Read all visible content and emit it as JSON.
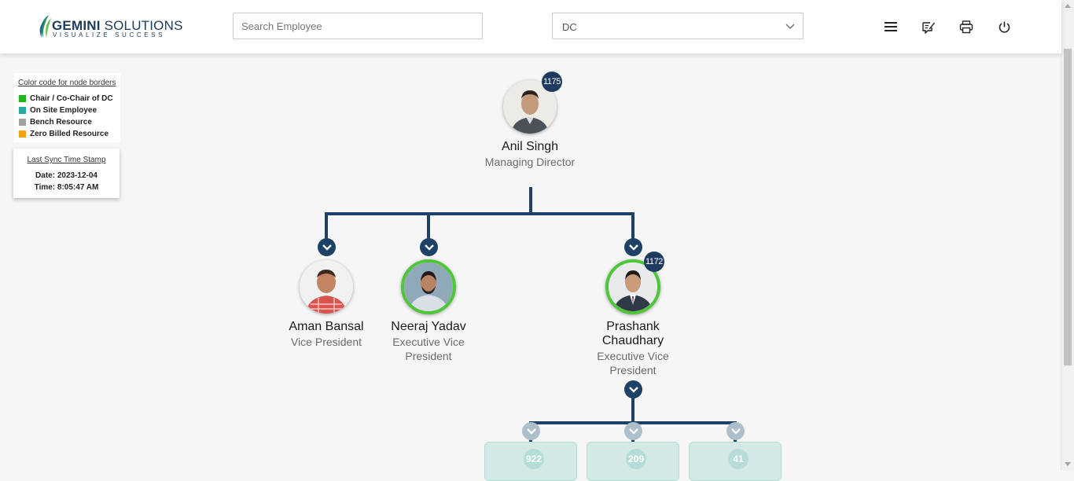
{
  "header": {
    "logo_main_bold": "GEMINI",
    "logo_main_rest": " SOLUTIONS",
    "logo_tagline": "VISUALIZE SUCCESS",
    "search_placeholder": "Search Employee",
    "department_select_value": "DC",
    "icons": [
      "menu-icon",
      "feedback-edit-icon",
      "print-icon",
      "power-icon"
    ]
  },
  "legend": {
    "title": "Color code for node borders",
    "items": [
      {
        "label": "Chair / Co-Chair of DC",
        "color": "#22b41c"
      },
      {
        "label": "On Site Employee",
        "color": "#2aa7a0"
      },
      {
        "label": "Bench Resource",
        "color": "#a2a2a2"
      },
      {
        "label": "Zero Billed Resource",
        "color": "#f5a30c"
      }
    ]
  },
  "sync": {
    "title": "Last Sync Time Stamp",
    "date": "Date: 2023-12-04",
    "time": "Time: 8:05:47 AM"
  },
  "org": {
    "root": {
      "name": "Anil Singh",
      "title": "Managing Director",
      "count": "1175"
    },
    "children": [
      {
        "name": "Aman Bansal",
        "title": "Vice President",
        "count": ""
      },
      {
        "name": "Neeraj Yadav",
        "title": "Executive Vice President",
        "count": ""
      },
      {
        "name": "Prashank Chaudhary",
        "title": "Executive Vice President",
        "count": "1172"
      }
    ],
    "grandchildren_counts": [
      "922",
      "209",
      "41"
    ]
  },
  "colors": {
    "connector": "#1d4266",
    "chair_border": "#4fc53a",
    "badge": "#1e3a5f",
    "mini_card": "#d4e9e6"
  }
}
